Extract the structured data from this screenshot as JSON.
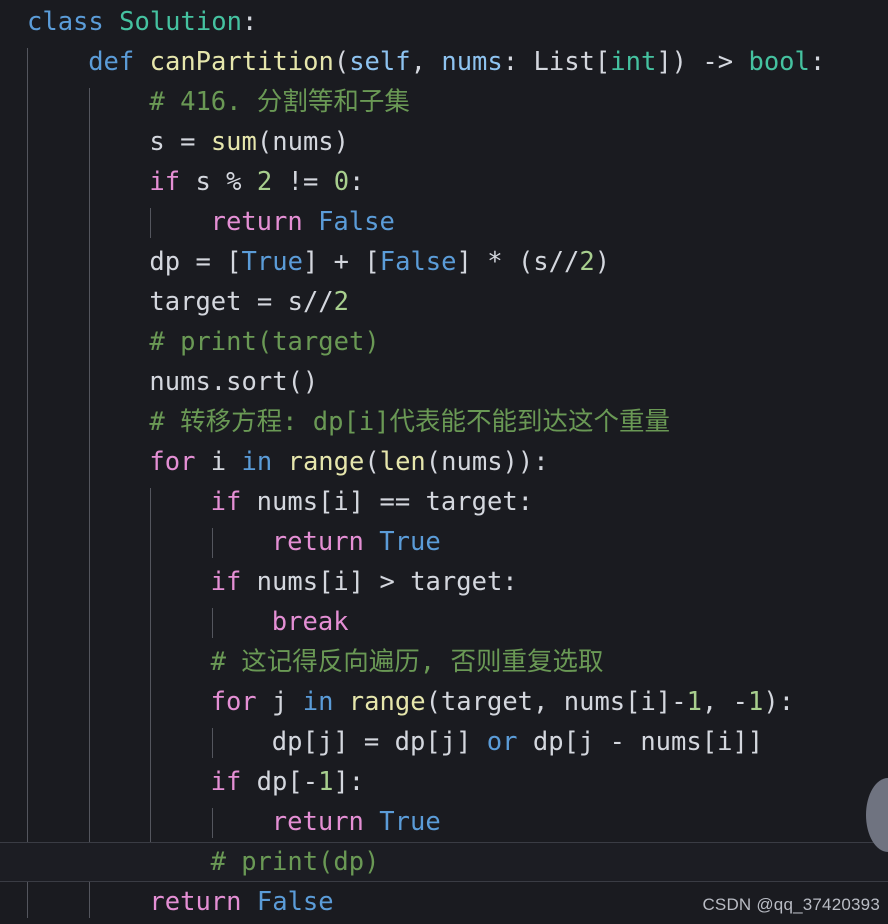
{
  "editor": {
    "background": "#1a1b20",
    "language": "python",
    "current_line_index": 19,
    "colors": {
      "background": "#1a1b20",
      "default_text": "#d4d7de",
      "keyword": "#e48fd4",
      "keyword_blue": "#5b9cd8",
      "class_type": "#45c2a0",
      "function": "#e6e6ac",
      "parameter": "#8ec3f0",
      "constant": "#5b9cd8",
      "number": "#a8cf8e",
      "comment": "#6a9955",
      "indent_guide": "#54565e",
      "scrollbar_thumb": "#6f7380",
      "current_line_border": "#3a3c44"
    },
    "indent_guides_x": [
      27,
      89,
      150,
      212
    ],
    "scrollbar": {
      "visible": true,
      "shape": "circle-thumb"
    }
  },
  "code_lines": [
    {
      "indent": 0,
      "tokens": [
        {
          "t": "class",
          "c": "kw-blue"
        },
        {
          "t": " ",
          "c": "plain"
        },
        {
          "t": "Solution",
          "c": "cls"
        },
        {
          "t": ":",
          "c": "plain"
        }
      ]
    },
    {
      "indent": 1,
      "tokens": [
        {
          "t": "def",
          "c": "kw-blue"
        },
        {
          "t": " ",
          "c": "plain"
        },
        {
          "t": "canPartition",
          "c": "fn"
        },
        {
          "t": "(",
          "c": "plain"
        },
        {
          "t": "self",
          "c": "param"
        },
        {
          "t": ", ",
          "c": "plain"
        },
        {
          "t": "nums",
          "c": "param"
        },
        {
          "t": ": ",
          "c": "plain"
        },
        {
          "t": "List",
          "c": "plain"
        },
        {
          "t": "[",
          "c": "plain"
        },
        {
          "t": "int",
          "c": "cls"
        },
        {
          "t": "]) ",
          "c": "plain"
        },
        {
          "t": "->",
          "c": "plain"
        },
        {
          "t": " ",
          "c": "plain"
        },
        {
          "t": "bool",
          "c": "cls"
        },
        {
          "t": ":",
          "c": "plain"
        }
      ]
    },
    {
      "indent": 2,
      "tokens": [
        {
          "t": "# 416. 分割等和子集",
          "c": "com"
        }
      ]
    },
    {
      "indent": 2,
      "tokens": [
        {
          "t": "s ",
          "c": "plain"
        },
        {
          "t": "= ",
          "c": "plain"
        },
        {
          "t": "sum",
          "c": "fn"
        },
        {
          "t": "(nums)",
          "c": "plain"
        }
      ]
    },
    {
      "indent": 2,
      "tokens": [
        {
          "t": "if",
          "c": "kw"
        },
        {
          "t": " s ",
          "c": "plain"
        },
        {
          "t": "% ",
          "c": "plain"
        },
        {
          "t": "2",
          "c": "num"
        },
        {
          "t": " ",
          "c": "plain"
        },
        {
          "t": "!=",
          "c": "plain"
        },
        {
          "t": " ",
          "c": "plain"
        },
        {
          "t": "0",
          "c": "num"
        },
        {
          "t": ":",
          "c": "plain"
        }
      ]
    },
    {
      "indent": 3,
      "tokens": [
        {
          "t": "return",
          "c": "kw"
        },
        {
          "t": " ",
          "c": "plain"
        },
        {
          "t": "False",
          "c": "const"
        }
      ]
    },
    {
      "indent": 2,
      "tokens": [
        {
          "t": "dp ",
          "c": "plain"
        },
        {
          "t": "= ",
          "c": "plain"
        },
        {
          "t": "[",
          "c": "plain"
        },
        {
          "t": "True",
          "c": "const"
        },
        {
          "t": "] ",
          "c": "plain"
        },
        {
          "t": "+ ",
          "c": "plain"
        },
        {
          "t": "[",
          "c": "plain"
        },
        {
          "t": "False",
          "c": "const"
        },
        {
          "t": "] ",
          "c": "plain"
        },
        {
          "t": "* ",
          "c": "plain"
        },
        {
          "t": "(s",
          "c": "plain"
        },
        {
          "t": "//",
          "c": "plain"
        },
        {
          "t": "2",
          "c": "num"
        },
        {
          "t": ")",
          "c": "plain"
        }
      ]
    },
    {
      "indent": 2,
      "tokens": [
        {
          "t": "target ",
          "c": "plain"
        },
        {
          "t": "= ",
          "c": "plain"
        },
        {
          "t": "s",
          "c": "plain"
        },
        {
          "t": "//",
          "c": "plain"
        },
        {
          "t": "2",
          "c": "num"
        }
      ]
    },
    {
      "indent": 2,
      "tokens": [
        {
          "t": "# print(target)",
          "c": "com"
        }
      ]
    },
    {
      "indent": 2,
      "tokens": [
        {
          "t": "nums.",
          "c": "plain"
        },
        {
          "t": "sort",
          "c": "plain"
        },
        {
          "t": "()",
          "c": "plain"
        }
      ]
    },
    {
      "indent": 2,
      "tokens": [
        {
          "t": "# 转移方程: dp[i]代表能不能到达这个重量",
          "c": "com"
        }
      ]
    },
    {
      "indent": 2,
      "tokens": [
        {
          "t": "for",
          "c": "kw"
        },
        {
          "t": " i ",
          "c": "plain"
        },
        {
          "t": "in",
          "c": "kw-blue"
        },
        {
          "t": " ",
          "c": "plain"
        },
        {
          "t": "range",
          "c": "fn"
        },
        {
          "t": "(",
          "c": "plain"
        },
        {
          "t": "len",
          "c": "fn"
        },
        {
          "t": "(nums)):",
          "c": "plain"
        }
      ]
    },
    {
      "indent": 3,
      "tokens": [
        {
          "t": "if",
          "c": "kw"
        },
        {
          "t": " nums[i] ",
          "c": "plain"
        },
        {
          "t": "==",
          "c": "plain"
        },
        {
          "t": " target:",
          "c": "plain"
        }
      ]
    },
    {
      "indent": 4,
      "tokens": [
        {
          "t": "return",
          "c": "kw"
        },
        {
          "t": " ",
          "c": "plain"
        },
        {
          "t": "True",
          "c": "const"
        }
      ]
    },
    {
      "indent": 3,
      "tokens": [
        {
          "t": "if",
          "c": "kw"
        },
        {
          "t": " nums[i] ",
          "c": "plain"
        },
        {
          "t": ">",
          "c": "plain"
        },
        {
          "t": " target:",
          "c": "plain"
        }
      ]
    },
    {
      "indent": 4,
      "tokens": [
        {
          "t": "break",
          "c": "kw"
        }
      ]
    },
    {
      "indent": 3,
      "tokens": [
        {
          "t": "# 这记得反向遍历, 否则重复选取",
          "c": "com"
        }
      ]
    },
    {
      "indent": 3,
      "tokens": [
        {
          "t": "for",
          "c": "kw"
        },
        {
          "t": " j ",
          "c": "plain"
        },
        {
          "t": "in",
          "c": "kw-blue"
        },
        {
          "t": " ",
          "c": "plain"
        },
        {
          "t": "range",
          "c": "fn"
        },
        {
          "t": "(target, nums[i]",
          "c": "plain"
        },
        {
          "t": "-",
          "c": "plain"
        },
        {
          "t": "1",
          "c": "num"
        },
        {
          "t": ", ",
          "c": "plain"
        },
        {
          "t": "-",
          "c": "plain"
        },
        {
          "t": "1",
          "c": "num"
        },
        {
          "t": "):",
          "c": "plain"
        }
      ]
    },
    {
      "indent": 4,
      "tokens": [
        {
          "t": "dp[j] ",
          "c": "plain"
        },
        {
          "t": "= ",
          "c": "plain"
        },
        {
          "t": "dp[j] ",
          "c": "plain"
        },
        {
          "t": "or",
          "c": "kw-blue"
        },
        {
          "t": " dp[j ",
          "c": "plain"
        },
        {
          "t": "- ",
          "c": "plain"
        },
        {
          "t": "nums[i]]",
          "c": "plain"
        }
      ]
    },
    {
      "indent": 3,
      "tokens": [
        {
          "t": "if",
          "c": "kw"
        },
        {
          "t": " dp[",
          "c": "plain"
        },
        {
          "t": "-",
          "c": "plain"
        },
        {
          "t": "1",
          "c": "num"
        },
        {
          "t": "]:",
          "c": "plain"
        }
      ]
    },
    {
      "indent": 4,
      "tokens": [
        {
          "t": "return",
          "c": "kw"
        },
        {
          "t": " ",
          "c": "plain"
        },
        {
          "t": "True",
          "c": "const"
        }
      ]
    },
    {
      "indent": 3,
      "current": true,
      "tokens": [
        {
          "t": "# print(dp)",
          "c": "com"
        }
      ]
    },
    {
      "indent": 2,
      "tokens": [
        {
          "t": "return",
          "c": "kw"
        },
        {
          "t": " ",
          "c": "plain"
        },
        {
          "t": "False",
          "c": "const"
        }
      ]
    }
  ],
  "watermark": {
    "text": "CSDN @qq_37420393"
  }
}
